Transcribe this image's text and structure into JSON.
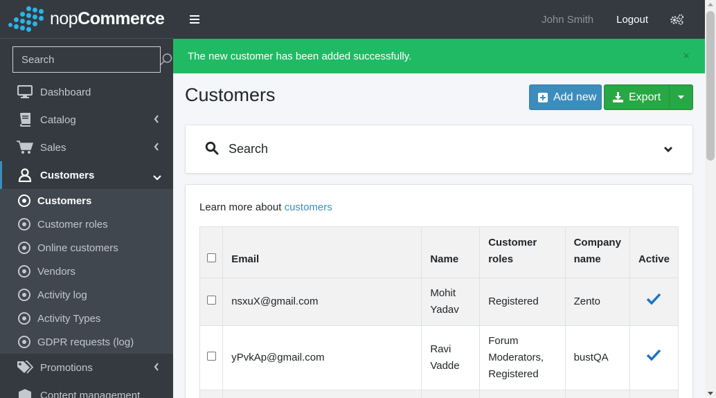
{
  "brand": {
    "prefix": "nop",
    "name": "Commerce"
  },
  "sidebar": {
    "search_placeholder": "Search",
    "items": [
      {
        "label": "Dashboard",
        "icon": "desktop-icon",
        "has_chevron": false
      },
      {
        "label": "Catalog",
        "icon": "book-icon",
        "has_chevron": true
      },
      {
        "label": "Sales",
        "icon": "cart-icon",
        "has_chevron": true
      },
      {
        "label": "Customers",
        "icon": "user-icon",
        "has_chevron": true,
        "active": true
      }
    ],
    "sub_items": [
      {
        "label": "Customers",
        "active": true
      },
      {
        "label": "Customer roles"
      },
      {
        "label": "Online customers"
      },
      {
        "label": "Vendors"
      },
      {
        "label": "Activity log"
      },
      {
        "label": "Activity Types"
      },
      {
        "label": "GDPR requests (log)"
      }
    ],
    "after_items": [
      {
        "label": "Promotions",
        "icon": "tags-icon"
      },
      {
        "label": "Content management",
        "icon": "cube-icon"
      }
    ]
  },
  "topbar": {
    "user_name": "John Smith",
    "logout_label": "Logout"
  },
  "alert": {
    "message": "The new customer has been added successfully.",
    "close": "×"
  },
  "page": {
    "title": "Customers",
    "add_new_label": "Add new",
    "export_label": "Export",
    "search_label": "Search",
    "learn_prefix": "Learn more about ",
    "learn_link": "customers"
  },
  "table": {
    "headers": [
      "Email",
      "Name",
      "Customer roles",
      "Company name",
      "Active"
    ],
    "rows": [
      {
        "email": "nsxuX@gmail.com",
        "name": "Mohit Yadav",
        "roles": "Registered",
        "company": "Zento",
        "active": true
      },
      {
        "email": "yPvkAp@gmail.com",
        "name": "Ravi Vadde",
        "roles": "Forum Moderators, Registered",
        "company": "bustQA",
        "active": true
      }
    ]
  },
  "colors": {
    "accent": "#3c8dbc",
    "success": "#28a745",
    "alert": "#21ba64",
    "sidebar": "#343a40"
  }
}
